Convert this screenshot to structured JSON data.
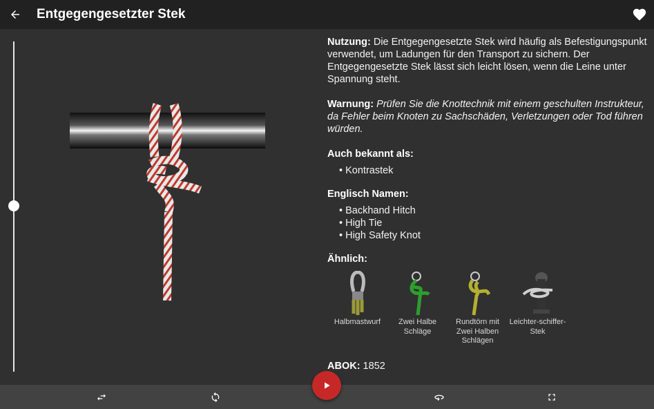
{
  "appbar": {
    "title": "Entgegengesetzter Stek",
    "back_icon": "arrow-back-icon",
    "favorite_icon": "heart-icon"
  },
  "slider": {
    "position": 0.52
  },
  "info": {
    "usage_label": "Nutzung:",
    "usage_text": " Die Entgegengesetzte Stek wird häufig als Befestigungspunkt verwendet, um Ladungen für den Transport zu sichern. Der Entgegengesetzte Stek lässt sich leicht lösen, wenn die Leine unter Spannung steht.",
    "warning_label": "Warnung:",
    "warning_text": " Prüfen Sie die Knottechnik mit einem geschulten Instrukteur, da Fehler beim Knoten zu Sachschäden, Verletzungen oder Tod führen würden.",
    "aka_heading": "Auch bekannt als:",
    "aka": [
      "Kontrastek"
    ],
    "english_heading": "Englisch Namen:",
    "english": [
      "Backhand Hitch",
      "High Tie",
      "High Safety Knot"
    ],
    "similar_heading": "Ähnlich:",
    "similar": [
      {
        "label": "Halbmastwurf",
        "color": "#9a9a3a"
      },
      {
        "label": "Zwei Halbe Schläge",
        "color": "#2e9e2e"
      },
      {
        "label": "Rundtörn mit Zwei Halben Schlägen",
        "color": "#b5b030"
      },
      {
        "label": "Leichter-schiffer-Stek",
        "color": "#cfcfcf"
      }
    ],
    "abok_label": "ABOK:",
    "abok_value": " 1852"
  },
  "bottombar": {
    "icons": [
      "swap-horiz-icon",
      "sync-icon",
      "rotate-icon",
      "fullscreen-icon"
    ],
    "play_icon": "play-icon",
    "play_color": "#c62828"
  }
}
